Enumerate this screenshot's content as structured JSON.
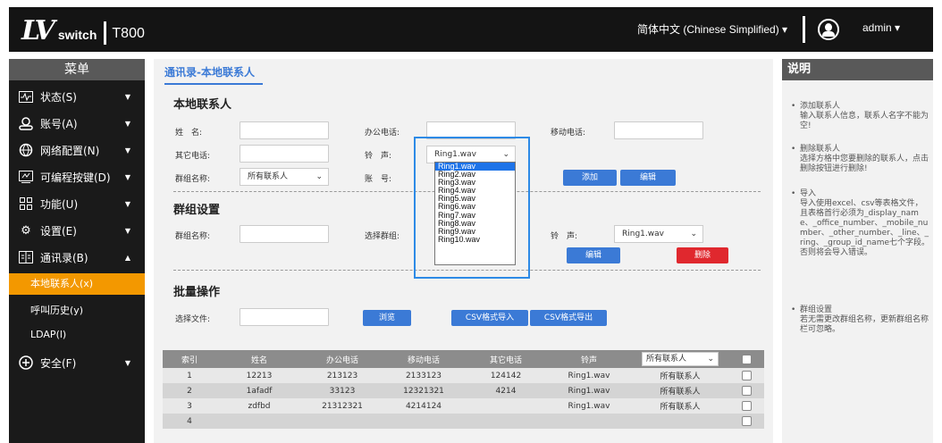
{
  "header": {
    "brand_lv": "LV",
    "brand_switch": "switch",
    "model": "T800",
    "language": "简体中文 (Chinese Simplified) ▾",
    "user": "admin ▾"
  },
  "sidebar": {
    "title": "菜单",
    "items": [
      {
        "label": "状态(S)",
        "icon": "status-icon"
      },
      {
        "label": "账号(A)",
        "icon": "account-icon"
      },
      {
        "label": "网络配置(N)",
        "icon": "network-icon"
      },
      {
        "label": "可编程按键(D)",
        "icon": "keypad-icon"
      },
      {
        "label": "功能(U)",
        "icon": "grid-icon"
      },
      {
        "label": "设置(E)",
        "icon": "gear-icon"
      },
      {
        "label": "通讯录(B)",
        "icon": "contacts-icon"
      }
    ],
    "subitems": [
      "本地联系人(x)",
      "呼叫历史(y)",
      "LDAP(l)"
    ],
    "security": "安全(F)"
  },
  "main": {
    "breadcrumb": "通讯录-本地联系人",
    "local_contacts": {
      "heading": "本地联系人",
      "name_label": "姓　名:",
      "office_label": "办公电话:",
      "mobile_label": "移动电话:",
      "other_label": "其它电话:",
      "ring_label": "铃　声:",
      "ring_value": "Ring1.wav",
      "group_label": "群组名称:",
      "group_value": "所有联系人",
      "account_label": "账　号:",
      "add_button": "添加",
      "edit_button": "编辑"
    },
    "group_settings": {
      "heading": "群组设置",
      "group_name_label": "群组名称:",
      "select_group_label": "选择群组:",
      "ring_label": "铃　声:",
      "ring_value": "Ring1.wav",
      "edit_button": "编辑",
      "delete_button": "删除"
    },
    "batch": {
      "heading": "批量操作",
      "file_label": "选择文件:",
      "browse_button": "浏览",
      "import_button": "CSV格式导入",
      "export_button": "CSV格式导出"
    },
    "ring_dropdown": {
      "options": [
        "Ring1.wav",
        "Ring2.wav",
        "Ring3.wav",
        "Ring4.wav",
        "Ring5.wav",
        "Ring6.wav",
        "Ring7.wav",
        "Ring8.wav",
        "Ring9.wav",
        "Ring10.wav"
      ],
      "highlighted": "Ring1.wav"
    },
    "table": {
      "headers": [
        "索引",
        "姓名",
        "办公电话",
        "移动电话",
        "其它电话",
        "铃声"
      ],
      "filter_value": "所有联系人",
      "rows": [
        [
          "1",
          "12213",
          "213123",
          "2133123",
          "124142",
          "Ring1.wav",
          "所有联系人"
        ],
        [
          "2",
          "1afadf",
          "33123",
          "12321321",
          "4214",
          "Ring1.wav",
          "所有联系人"
        ],
        [
          "3",
          "zdfbd",
          "21312321",
          "4214124",
          "",
          "Ring1.wav",
          "所有联系人"
        ],
        [
          "4",
          "",
          "",
          "",
          "",
          "",
          ""
        ]
      ]
    }
  },
  "help": {
    "title": "说明",
    "items": [
      {
        "title": "添加联系人",
        "desc": "输入联系人信息，联系人名字不能为空!"
      },
      {
        "title": "删除联系人",
        "desc": "选择方格中您要删除的联系人，点击删除按钮进行删除!"
      },
      {
        "title": "导入",
        "desc": "导入使用excel、csv等表格文件，且表格首行必须为_display_name、_office_number、_mobile_number、_other_number、_line、_ring、_group_id_name七个字段。否则将会导入错误。"
      },
      {
        "title": "群组设置",
        "desc": "若无需更改群组名称，更新群组名称栏可忽略。"
      }
    ]
  },
  "colors": {
    "accent_orange": "#f39800",
    "accent_blue": "#3b7ad6",
    "danger_red": "#e0282e",
    "topbar": "#141414"
  }
}
